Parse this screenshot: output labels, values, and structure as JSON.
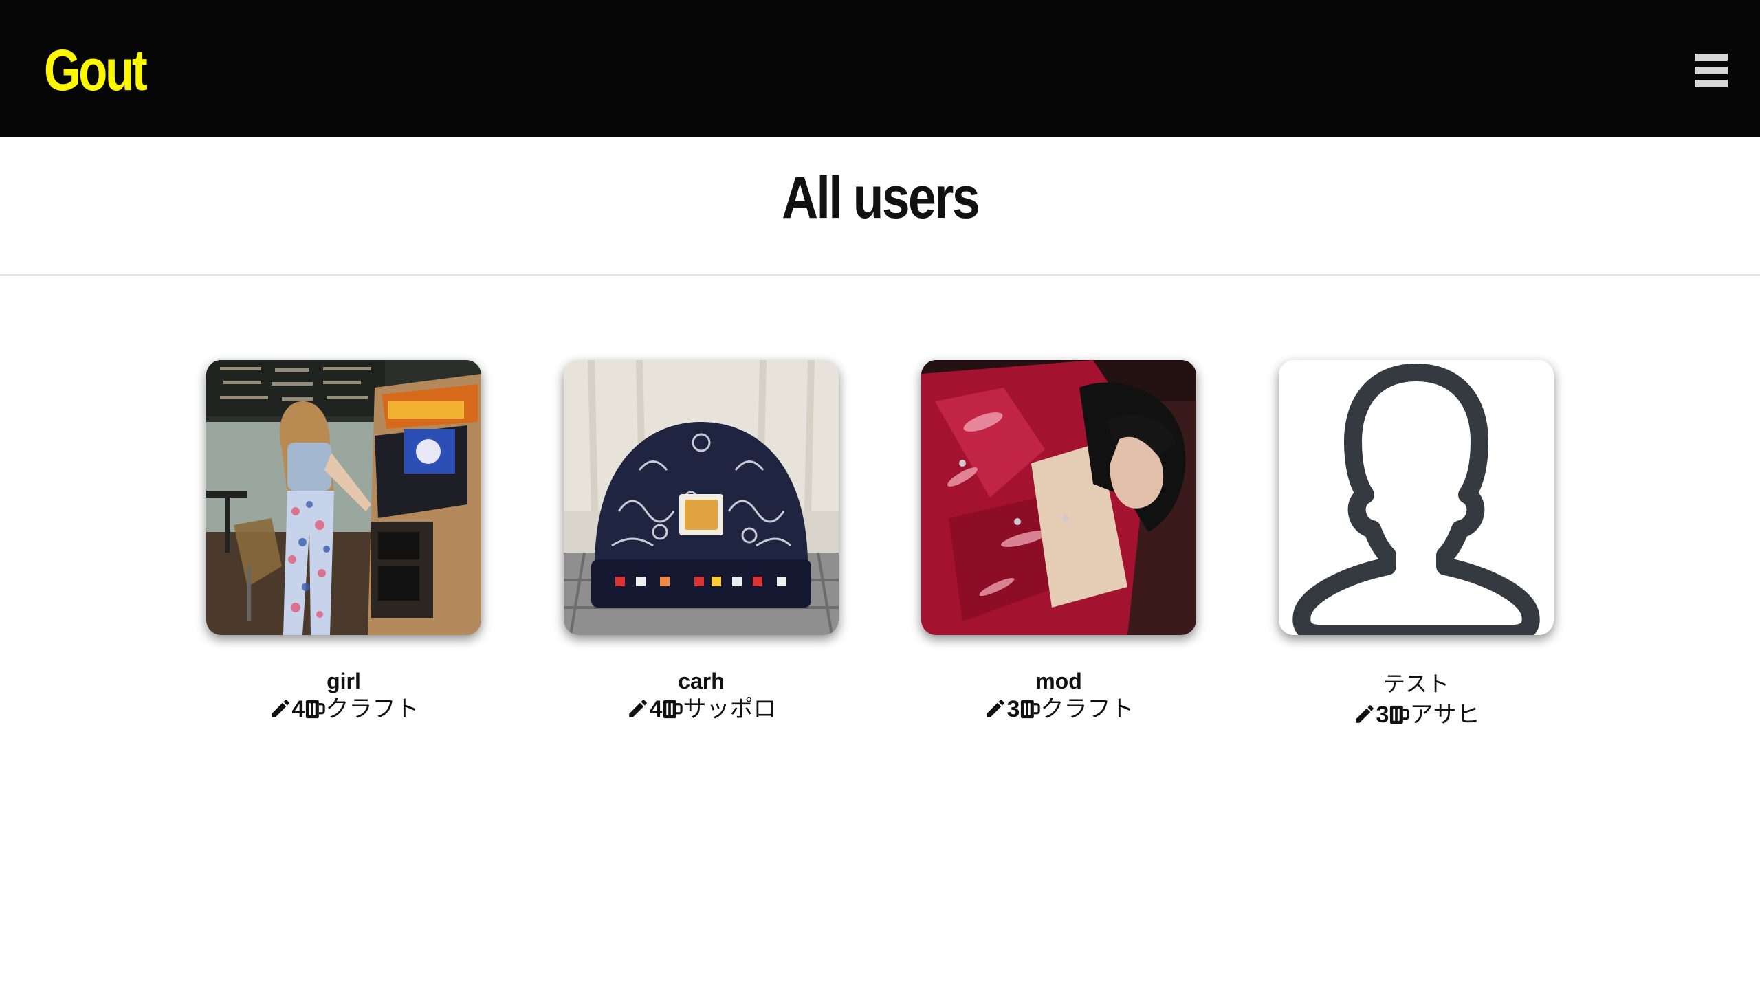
{
  "header": {
    "logo": "Gout",
    "menu_icon": "hamburger-menu-icon",
    "background": "#060606",
    "logo_color": "#fdf700"
  },
  "main": {
    "title": "All users"
  },
  "users": [
    {
      "name": "girl",
      "post_count": "4",
      "favorite_beer": "クラフト",
      "avatar": "photo-girl-arcade"
    },
    {
      "name": "carh",
      "post_count": "4",
      "favorite_beer": "サッポロ",
      "avatar": "photo-beanie-hat"
    },
    {
      "name": "mod",
      "post_count": "3",
      "favorite_beer": "クラフト",
      "avatar": "photo-red-jacket"
    },
    {
      "name": "テスト",
      "post_count": "3",
      "favorite_beer": "アサヒ",
      "avatar": "default-user-icon"
    }
  ],
  "icons": {
    "post": "pencil-icon",
    "beer": "beer-mug-icon"
  }
}
